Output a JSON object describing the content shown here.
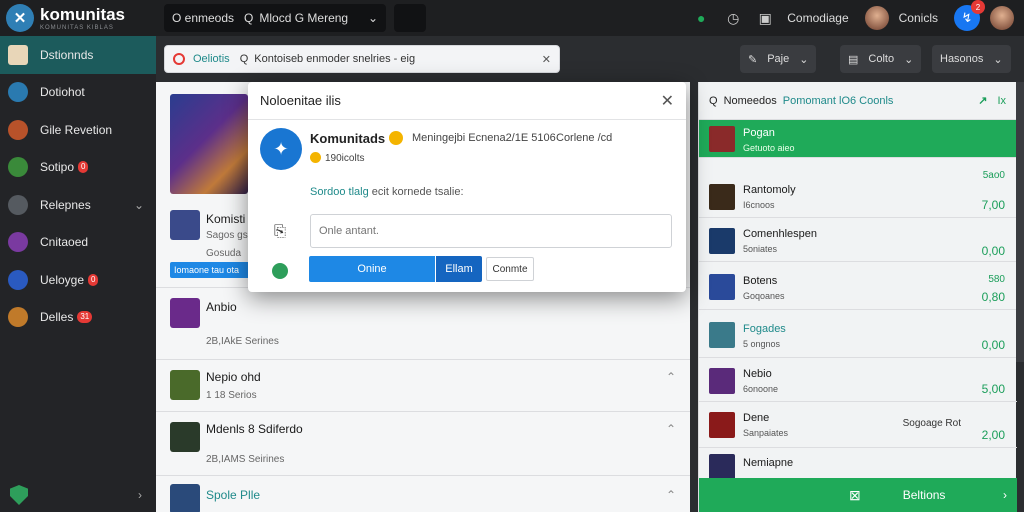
{
  "topbar": {
    "brand": "komunitas",
    "brand_sub": "KOMUNITAS KIBLAS",
    "search_icon": "search-icon",
    "search_label": "O enmeods",
    "search_value": "Mlocd G Mereng",
    "compose_label": "Comodiage",
    "user_label": "Conicls",
    "messenger_badge": "2"
  },
  "sidebar": {
    "items": [
      {
        "label": "Dstionnds",
        "badge": "",
        "chevron": false
      },
      {
        "label": "Dotiohot",
        "badge": "",
        "chevron": false
      },
      {
        "label": "Gile Revetion",
        "badge": "",
        "chevron": false
      },
      {
        "label": "Sotipo",
        "badge": "0",
        "chevron": false
      },
      {
        "label": "Relepnes",
        "badge": "",
        "chevron": true
      },
      {
        "label": "Cnitaoed",
        "badge": "",
        "chevron": false
      },
      {
        "label": "Ueloyge",
        "badge": "0",
        "chevron": false
      },
      {
        "label": "Delles",
        "badge": "31",
        "chevron": false
      }
    ]
  },
  "filterbar": {
    "tag": "Oeliotis",
    "search_value": "Kontoiseb enmoder snelries - eig",
    "btn1": "Paje",
    "btn2": "Colto",
    "btn3": "Hasonos"
  },
  "feed": {
    "hero_title": "Komisti",
    "hero_sub": "Sagos  gs",
    "hero_meta": "Gosuda",
    "chip": "Iomaone tau ota",
    "rows": [
      {
        "title": "Anbio",
        "sub": "",
        "meta": "2B,IAkE Serines"
      },
      {
        "title": "Nepio ohd",
        "sub": "",
        "meta": "1 18  Serios"
      },
      {
        "title": "Mdenls 8 Sdiferdo",
        "sub": "",
        "meta": "2B,IAMS Seirines"
      },
      {
        "title": "Spole Plle",
        "sub": "",
        "meta": ""
      }
    ]
  },
  "modal": {
    "title": "Noloenitae ilis",
    "name": "Komunitads",
    "meta": "Meningejbi Ecnena2/1E 5106",
    "meta2": "Corlene /cd",
    "followers": "190icolts",
    "link": "Sordoo tlalg",
    "link_rest": "ecit kornede tsalie:",
    "input_placeholder": "Onle antant.",
    "btn_primary": "Onine",
    "btn_split": "Ellam",
    "btn_secondary": "Conmte"
  },
  "rpanel": {
    "header_label": "Nomeedos",
    "header_tag": "Pomomant lO6 Coonls",
    "trend": "Ix",
    "items": [
      {
        "title": "Pogan",
        "sub": "Getuoto aieo",
        "val1": "",
        "val2": "",
        "label": ""
      },
      {
        "title": "Rantomoly",
        "sub": "I6cnoos",
        "val1": "5ao0",
        "val2": "7,00",
        "label": ""
      },
      {
        "title": "Comenhlespen",
        "sub": "5oniates",
        "val1": "",
        "val2": "0,00",
        "label": ""
      },
      {
        "title": "Botens",
        "sub": "Goqoanes",
        "val1": "580",
        "val2": "0,80",
        "label": ""
      },
      {
        "title": "Fogades",
        "sub": "5 ongnos",
        "val1": "",
        "val2": "0,00",
        "label": ""
      },
      {
        "title": "Nebio",
        "sub": "6onoone",
        "val1": "",
        "val2": "5,00",
        "label": ""
      },
      {
        "title": "Dene",
        "sub": "Sanpaiates",
        "val1": "",
        "val2": "2,00",
        "label": "Sogoage Rot"
      },
      {
        "title": "Nemiapne",
        "sub": "",
        "val1": "",
        "val2": "",
        "label": ""
      }
    ],
    "footer": "Beltions"
  }
}
